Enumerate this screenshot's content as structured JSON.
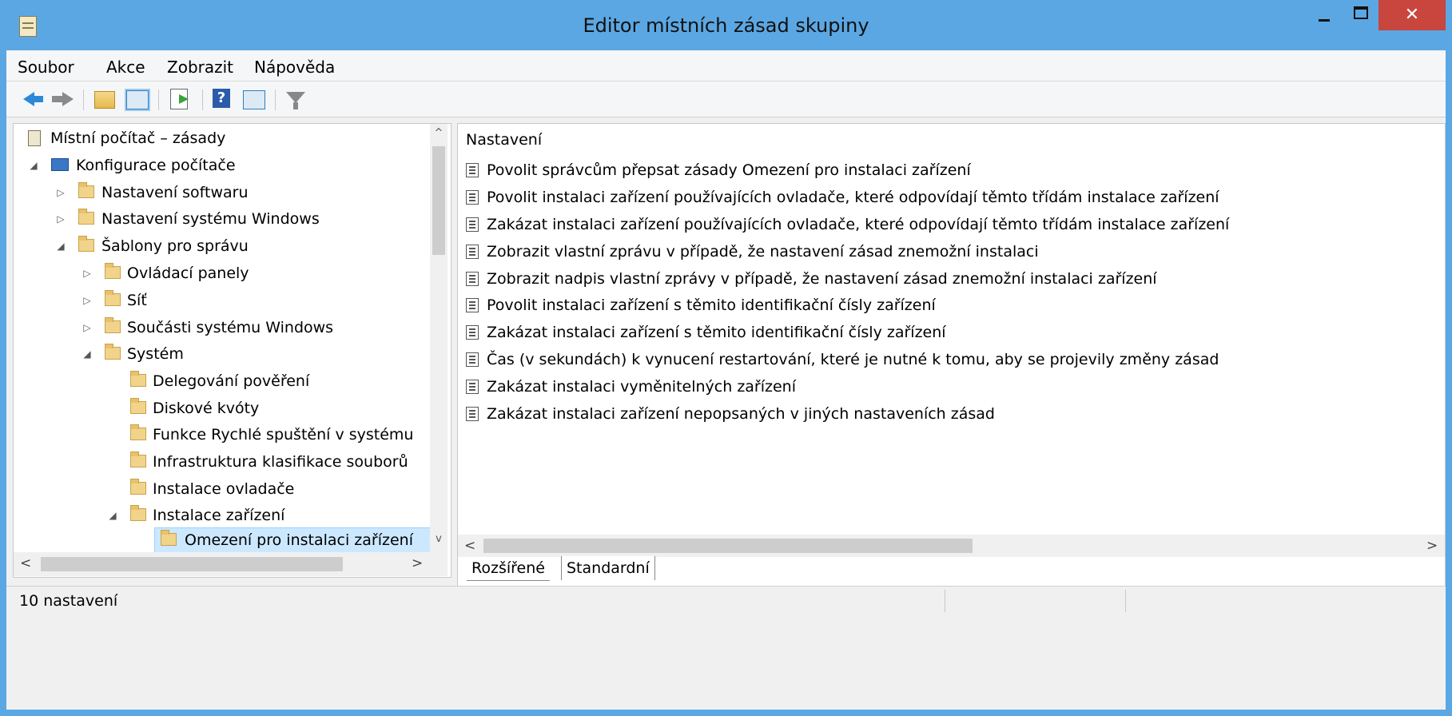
{
  "window": {
    "title": "Editor místních zásad skupiny",
    "close_glyph": "✕"
  },
  "menu": [
    "Soubor",
    "Akce",
    "Zobrazit",
    "Nápověda"
  ],
  "toolbar_icons": [
    "back-arrow-icon",
    "forward-arrow-icon",
    "up-folder-icon",
    "show-tree-icon",
    "export-list-icon",
    "help-icon",
    "action-pane-icon",
    "filter-icon"
  ],
  "tree": [
    {
      "label": "Místní počítač – zásady",
      "icon": "policy-root-icon",
      "expander": ""
    },
    {
      "label": "Konfigurace počítače",
      "icon": "computer-icon",
      "expander": "◢"
    },
    {
      "label": "Nastavení softwaru",
      "icon": "folder-icon",
      "expander": "▷"
    },
    {
      "label": "Nastavení systému Windows",
      "icon": "folder-icon",
      "expander": "▷"
    },
    {
      "label": "Šablony pro správu",
      "icon": "folder-icon",
      "expander": "◢"
    },
    {
      "label": "Ovládací panely",
      "icon": "folder-icon",
      "expander": "▷"
    },
    {
      "label": "Síť",
      "icon": "folder-icon",
      "expander": "▷"
    },
    {
      "label": "Součásti systému Windows",
      "icon": "folder-icon",
      "expander": "▷"
    },
    {
      "label": "Systém",
      "icon": "folder-icon",
      "expander": "◢"
    },
    {
      "label": "Delegování pověření",
      "icon": "folder-icon",
      "expander": ""
    },
    {
      "label": "Diskové kvóty",
      "icon": "folder-icon",
      "expander": ""
    },
    {
      "label": "Funkce Rychlé spuštění v systému",
      "icon": "folder-icon",
      "expander": ""
    },
    {
      "label": "Infrastruktura klasifikace souborů",
      "icon": "folder-icon",
      "expander": ""
    },
    {
      "label": "Instalace ovladače",
      "icon": "folder-icon",
      "expander": ""
    },
    {
      "label": "Instalace zařízení",
      "icon": "folder-icon",
      "expander": "◢"
    },
    {
      "label": "Omezení pro instalaci zařízení",
      "icon": "folder-icon",
      "expander": "",
      "selected": true
    }
  ],
  "settings_header": "Nastavení",
  "settings": [
    "Povolit správcům přepsat zásady Omezení pro instalaci zařízení",
    "Povolit instalaci zařízení používajících ovladače, které odpovídají těmto třídám instalace zařízení",
    "Zakázat instalaci zařízení používajících ovladače, které odpovídají těmto třídám instalace zařízení",
    "Zobrazit vlastní zprávu v případě, že nastavení zásad znemožní instalaci",
    "Zobrazit nadpis vlastní zprávy v případě, že nastavení zásad znemožní instalaci zařízení",
    "Povolit instalaci zařízení s těmito identifikační čísly zařízení",
    "Zakázat instalaci zařízení s těmito identifikační čísly zařízení",
    "Čas (v sekundách) k vynucení restartování, které je nutné k tomu, aby se projevily změny zásad",
    "Zakázat instalaci vyměnitelných zařízení",
    "Zakázat instalaci zařízení nepopsaných v jiných nastaveních zásad"
  ],
  "tabs": {
    "extended": "Rozšířené",
    "standard": "Standardní"
  },
  "status": {
    "text": "10 nastavení"
  },
  "scroll_glyphs": {
    "up": "^",
    "down": "v",
    "left": "<",
    "right": ">"
  }
}
